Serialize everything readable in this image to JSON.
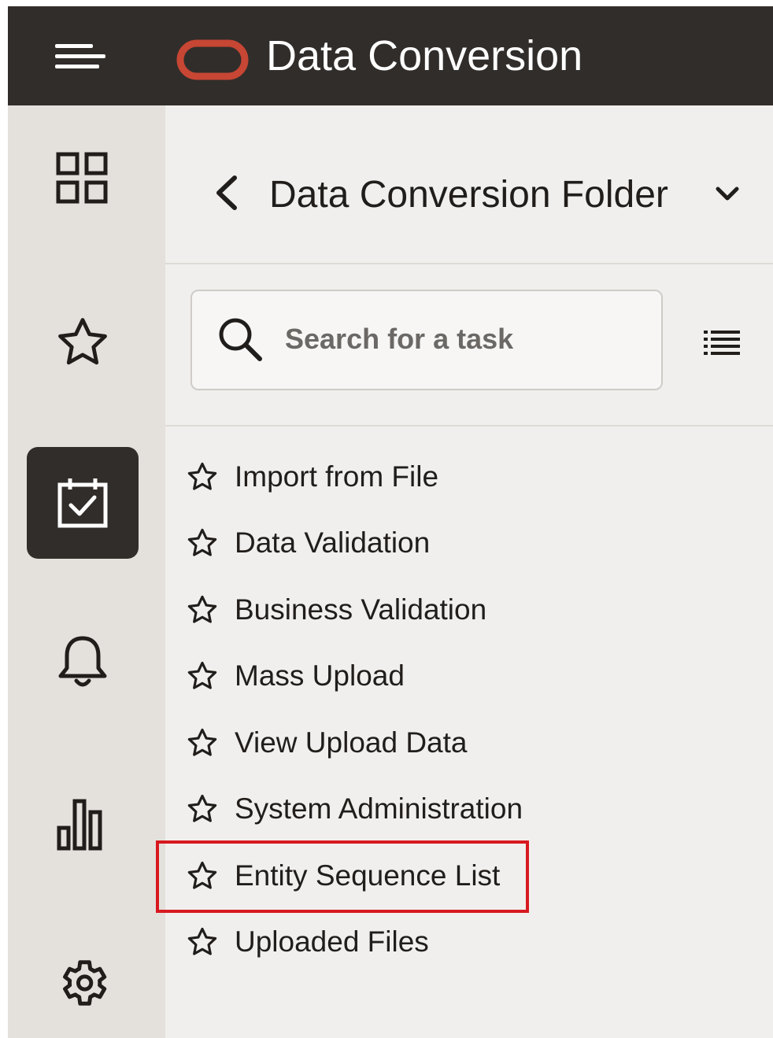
{
  "header": {
    "app_title": "Data Conversion",
    "brand_color": "#c74634",
    "background": "#312d2a",
    "menu_icon": "hamburger-menu-icon",
    "logo": "oracle-logo"
  },
  "rail": {
    "items": [
      {
        "icon": "apps-grid-icon",
        "active": false
      },
      {
        "icon": "star-icon",
        "active": false
      },
      {
        "icon": "calendar-check-icon",
        "active": true
      },
      {
        "icon": "bell-icon",
        "active": false
      },
      {
        "icon": "bar-chart-icon",
        "active": false
      },
      {
        "icon": "gear-icon",
        "active": false
      }
    ]
  },
  "panel": {
    "folder_title": "Data Conversion Folder",
    "search_placeholder": "Search for a task",
    "tasks": [
      {
        "label": "Import from File"
      },
      {
        "label": "Data Validation"
      },
      {
        "label": "Business Validation"
      },
      {
        "label": "Mass Upload"
      },
      {
        "label": "View Upload Data"
      },
      {
        "label": "System Administration"
      },
      {
        "label": "Entity Sequence List",
        "highlighted": true
      },
      {
        "label": "Uploaded Files"
      }
    ],
    "highlight_color": "#d7191f"
  }
}
